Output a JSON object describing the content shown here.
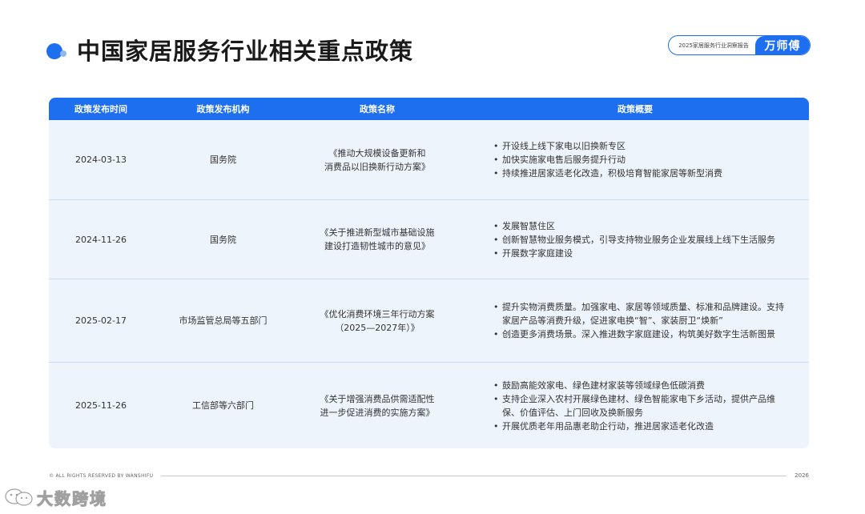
{
  "header": {
    "title": "中国家居服务行业相关重点政策",
    "report_name": "2025家居服务行业洞察报告",
    "brand_logo": "万师傅"
  },
  "table": {
    "columns": [
      "政策发布时间",
      "政策发布机构",
      "政策名称",
      "政策概要"
    ],
    "rows": [
      {
        "date": "2024-03-13",
        "agency": "国务院",
        "name": "《推动大规模设备更新和\n消费品以旧换新行动方案》",
        "summary": [
          "开设线上线下家电以旧换新专区",
          "加快实施家电售后服务提升行动",
          "持续推进居家适老化改造，积极培育智能家居等新型消费"
        ]
      },
      {
        "date": "2024-11-26",
        "agency": "国务院",
        "name": "《关于推进新型城市基础设施\n建设打造韧性城市的意见》",
        "summary": [
          "发展智慧住区",
          "创新智慧物业服务模式，引导支持物业服务企业发展线上线下生活服务",
          "开展数字家庭建设"
        ]
      },
      {
        "date": "2025-02-17",
        "agency": "市场监管总局等五部门",
        "name": "《优化消费环境三年行动方案\n（2025—2027年）》",
        "summary": [
          "提升实物消费质量。加强家电、家居等领域质量、标准和品牌建设。支持家居产品等消费升级，促进家电换“智”、家装厨卫“焕新”",
          "创造更多消费场景。深入推进数字家庭建设，构筑美好数字生活新图景"
        ]
      },
      {
        "date": "2025-11-26",
        "agency": "工信部等六部门",
        "name": "《关于增强消费品供需适配性\n进一步促进消费的实施方案》",
        "summary": [
          "鼓励高能效家电、绿色建材家装等领域绿色低碳消费",
          "支持企业深入农村开展绿色建材、绿色智能家电下乡活动，提供产品维保、价值评估、上门回收及换新服务",
          "开展优质老年用品惠老助企行动，推进居家适老化改造"
        ]
      }
    ]
  },
  "footer": {
    "copyright": "© ALL RIGHTS RESERVED BY WANSHIFU",
    "year": "2026"
  },
  "watermark": {
    "text": "大数跨境",
    "icon": "wechat-bubble-icon"
  },
  "colors": {
    "accent": "#1e6ff0",
    "table_bg": "#eef4fc",
    "row_divider": "#c9dbf5"
  }
}
